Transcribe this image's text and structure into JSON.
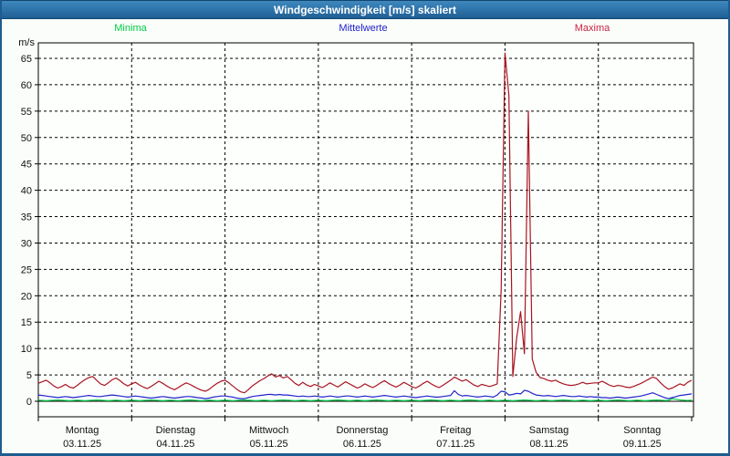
{
  "window": {
    "title": "Windgeschwindigkeit [m/s] skaliert"
  },
  "legend": {
    "items": [
      {
        "label": "Minima",
        "color": "#00cc44",
        "x": 143
      },
      {
        "label": "Mittelwerte",
        "color": "#2222cc",
        "x": 398
      },
      {
        "label": "Maxima",
        "color": "#cc2244",
        "x": 649
      }
    ]
  },
  "colors": {
    "frame": "#1d5c8f",
    "titlebar_light": "#3e88be",
    "titlebar_dark": "#1f5f95",
    "background": "#fafdfa",
    "grid": "#000000",
    "minima_line": "#00cc44",
    "mittelwerte_line": "#2222cc",
    "maxima_line": "#a81420"
  },
  "chart_data": {
    "type": "line",
    "title": "Windgeschwindigkeit [m/s] skaliert",
    "ylabel": "m/s",
    "xlabel": "",
    "grid": "dashed",
    "legend_position": "top",
    "ylim": [
      -3,
      69
    ],
    "y_ticks": [
      0,
      5,
      10,
      15,
      20,
      25,
      30,
      35,
      40,
      45,
      50,
      55,
      60,
      65
    ],
    "x_unit": "hours since Montag 03.11.25 00:00",
    "x_step_hours": 1,
    "x_days": [
      {
        "label": "Montag",
        "date": "03.11.25"
      },
      {
        "label": "Dienstag",
        "date": "04.11.25"
      },
      {
        "label": "Mittwoch",
        "date": "05.11.25"
      },
      {
        "label": "Donnerstag",
        "date": "06.11.25"
      },
      {
        "label": "Freitag",
        "date": "07.11.25"
      },
      {
        "label": "Samstag",
        "date": "08.11.25"
      },
      {
        "label": "Sonntag",
        "date": "09.11.25"
      }
    ],
    "series": [
      {
        "name": "Minima",
        "color": "#00cc44",
        "values": [
          0.2,
          0.15,
          0.1,
          0.15,
          0.2,
          0.25,
          0.2,
          0.15,
          0.1,
          0.15,
          0.2,
          0.15,
          0.1,
          0.15,
          0.2,
          0.25,
          0.2,
          0.15,
          0.1,
          0.15,
          0.2,
          0.15,
          0.1,
          0.15,
          0.2,
          0.15,
          0.1,
          0.15,
          0.2,
          0.25,
          0.2,
          0.15,
          0.1,
          0.15,
          0.2,
          0.15,
          0.1,
          0.15,
          0.2,
          0.25,
          0.2,
          0.15,
          0.1,
          0.15,
          0.2,
          0.15,
          0.1,
          0.15,
          0.2,
          0.15,
          0.1,
          0.15,
          0.2,
          0.25,
          0.2,
          0.15,
          0.1,
          0.15,
          0.2,
          0.15,
          0.1,
          0.15,
          0.2,
          0.25,
          0.2,
          0.15,
          0.1,
          0.15,
          0.2,
          0.15,
          0.1,
          0.15,
          0.2,
          0.15,
          0.1,
          0.15,
          0.2,
          0.25,
          0.2,
          0.15,
          0.1,
          0.15,
          0.2,
          0.15,
          0.1,
          0.15,
          0.2,
          0.25,
          0.2,
          0.15,
          0.1,
          0.15,
          0.2,
          0.15,
          0.1,
          0.15,
          0.2,
          0.15,
          0.1,
          0.15,
          0.2,
          0.25,
          0.2,
          0.15,
          0.1,
          0.15,
          0.2,
          0.15,
          0.1,
          0.15,
          0.2,
          0.25,
          0.2,
          0.15,
          0.1,
          0.15,
          0.2,
          0.15,
          0.1,
          0.15,
          0.2,
          0.15,
          0.1,
          0.15,
          0.2,
          0.25,
          0.2,
          0.15,
          0.1,
          0.15,
          0.2,
          0.15,
          0.1,
          0.15,
          0.2,
          0.25,
          0.2,
          0.15,
          0.1,
          0.15,
          0.2,
          0.15,
          0.1,
          0.15,
          0.2,
          0.15,
          0.1,
          0.15,
          0.2,
          0.25,
          0.2,
          0.15,
          0.1,
          0.15,
          0.2,
          0.15,
          0.1,
          0.15,
          0.2,
          0.25,
          0.2,
          0.15,
          0.15,
          0.5,
          0.4,
          0.25,
          0.2,
          0.15,
          0.2
        ]
      },
      {
        "name": "Mittelwerte",
        "color": "#2222cc",
        "values": [
          1.2,
          1.1,
          1.0,
          0.9,
          0.8,
          0.7,
          0.8,
          0.9,
          0.8,
          0.7,
          0.8,
          0.9,
          1.0,
          1.1,
          1.0,
          0.9,
          0.9,
          1.0,
          1.1,
          1.2,
          1.1,
          1.0,
          0.9,
          0.8,
          0.9,
          1.0,
          0.9,
          0.8,
          0.7,
          0.6,
          0.7,
          0.8,
          0.9,
          0.8,
          0.7,
          0.6,
          0.7,
          0.8,
          0.9,
          0.9,
          0.8,
          0.7,
          0.6,
          0.5,
          0.6,
          0.8,
          0.9,
          1.0,
          1.0,
          0.9,
          0.8,
          0.6,
          0.5,
          0.5,
          0.7,
          0.9,
          1.0,
          1.1,
          1.2,
          1.3,
          1.3,
          1.2,
          1.3,
          1.2,
          1.2,
          1.1,
          1.0,
          0.9,
          1.0,
          0.9,
          0.9,
          1.0,
          0.9,
          0.8,
          0.9,
          1.0,
          0.9,
          0.8,
          0.9,
          1.0,
          1.0,
          0.9,
          0.8,
          0.9,
          1.0,
          0.9,
          0.8,
          0.9,
          1.0,
          1.1,
          1.0,
          0.9,
          0.8,
          0.9,
          1.0,
          0.9,
          0.8,
          0.7,
          0.8,
          0.9,
          1.0,
          0.9,
          0.8,
          0.8,
          0.9,
          1.0,
          1.1,
          2.0,
          1.3,
          1.0,
          1.1,
          1.0,
          0.9,
          0.8,
          0.9,
          1.0,
          0.9,
          0.8,
          1.2,
          1.9,
          1.8,
          1.2,
          1.3,
          1.5,
          1.4,
          2.1,
          1.9,
          1.5,
          1.2,
          1.1,
          1.0,
          1.1,
          1.0,
          0.9,
          1.0,
          1.1,
          1.0,
          0.9,
          0.9,
          1.0,
          0.9,
          0.8,
          0.9,
          0.8,
          0.8,
          0.7,
          0.7,
          0.6,
          0.7,
          0.8,
          0.7,
          0.6,
          0.7,
          0.8,
          0.9,
          1.0,
          1.2,
          1.4,
          1.6,
          1.3,
          1.0,
          0.7,
          0.5,
          0.7,
          0.9,
          1.1,
          1.2,
          1.3,
          1.4
        ]
      },
      {
        "name": "Maxima",
        "color": "#a81420",
        "values": [
          3.4,
          3.7,
          4.0,
          3.5,
          2.9,
          2.5,
          2.8,
          3.2,
          2.7,
          2.5,
          3.0,
          3.6,
          4.1,
          4.5,
          4.7,
          4.0,
          3.3,
          3.0,
          3.5,
          4.1,
          4.4,
          3.9,
          3.3,
          2.9,
          3.3,
          3.6,
          3.1,
          2.7,
          2.4,
          2.8,
          3.3,
          3.8,
          3.4,
          2.9,
          2.5,
          2.2,
          2.6,
          3.1,
          3.5,
          3.2,
          2.8,
          2.4,
          2.1,
          1.9,
          2.3,
          2.9,
          3.4,
          3.8,
          4.0,
          3.5,
          2.9,
          2.3,
          1.8,
          1.6,
          2.2,
          2.9,
          3.4,
          3.9,
          4.3,
          4.8,
          5.2,
          4.6,
          4.9,
          4.4,
          4.7,
          4.1,
          3.4,
          3.0,
          3.6,
          3.1,
          2.8,
          3.2,
          2.9,
          2.6,
          3.0,
          3.5,
          3.1,
          2.7,
          3.2,
          3.7,
          3.3,
          2.9,
          2.5,
          2.8,
          3.3,
          2.9,
          2.6,
          3.0,
          3.5,
          3.9,
          3.4,
          3.0,
          2.7,
          3.1,
          3.6,
          3.2,
          2.8,
          2.5,
          2.9,
          3.4,
          3.8,
          3.3,
          2.9,
          2.6,
          3.0,
          3.5,
          4.0,
          4.6,
          4.2,
          3.8,
          4.1,
          3.6,
          3.1,
          2.8,
          3.2,
          3.0,
          2.8,
          3.0,
          3.3,
          21.0,
          66.0,
          58.0,
          4.7,
          12.0,
          17.0,
          9.0,
          55.0,
          8.0,
          5.5,
          4.5,
          4.3,
          4.0,
          3.8,
          4.0,
          3.6,
          3.3,
          3.1,
          3.0,
          3.1,
          3.3,
          3.6,
          3.3,
          3.4,
          3.5,
          3.5,
          3.8,
          3.4,
          3.0,
          2.8,
          3.0,
          2.9,
          2.7,
          2.6,
          2.8,
          3.1,
          3.4,
          3.8,
          4.2,
          4.6,
          4.3,
          3.5,
          2.8,
          2.3,
          2.5,
          2.9,
          3.3,
          3.0,
          3.6,
          4.0
        ]
      }
    ]
  }
}
